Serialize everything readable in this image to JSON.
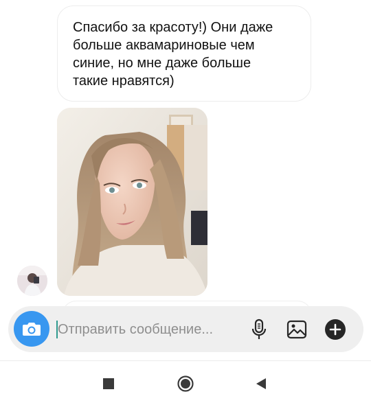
{
  "messages": [
    {
      "type": "text",
      "lines": [
        "Спасибо за красоту!) Они даже",
        "больше аквамариновые чем",
        "синие, но мне даже больше",
        "такие нравятся)"
      ]
    },
    {
      "type": "photo"
    }
  ],
  "composer": {
    "placeholder": "Отправить сообщение...",
    "camera_icon": "camera-icon",
    "mic_icon": "microphone-icon",
    "gallery_icon": "gallery-icon",
    "more_icon": "plus-circle-icon"
  },
  "system_nav": {
    "recents_icon": "square-icon",
    "home_icon": "circle-icon",
    "back_icon": "triangle-back-icon"
  },
  "colors": {
    "accent": "#3897f0",
    "bubble_border": "#ececec",
    "composer_bg": "#efefef"
  }
}
